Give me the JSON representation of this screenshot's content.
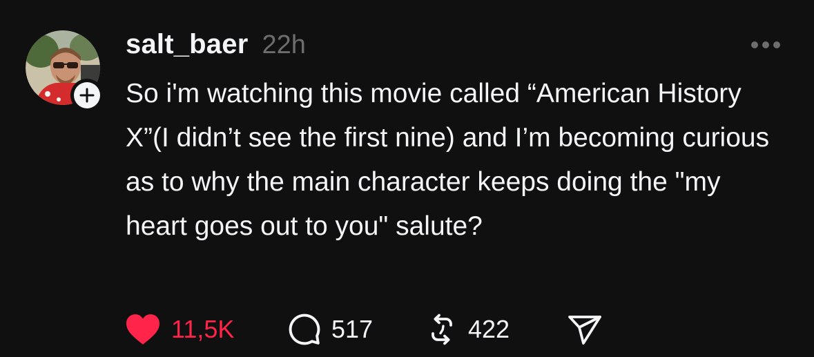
{
  "post": {
    "username": "salt_baer",
    "timestamp": "22h",
    "text": "So i'm watching this movie called “American History X”(I didn’t see the first nine) and I’m becoming curious as to why the main character keeps doing the \"my heart goes out to you\" salute?",
    "liked": true
  },
  "actions": {
    "likes": "11,5K",
    "replies": "517",
    "reposts": "422"
  },
  "icons": {
    "like": "heart-icon",
    "reply": "speech-bubble-icon",
    "repost": "repost-arrows-icon",
    "share": "paper-plane-icon",
    "follow": "plus-icon",
    "more": "ellipsis-icon"
  },
  "colors": {
    "background": "#101010",
    "text": "#f3f5f7",
    "secondary": "#6d6d6d",
    "like": "#ff2449"
  }
}
